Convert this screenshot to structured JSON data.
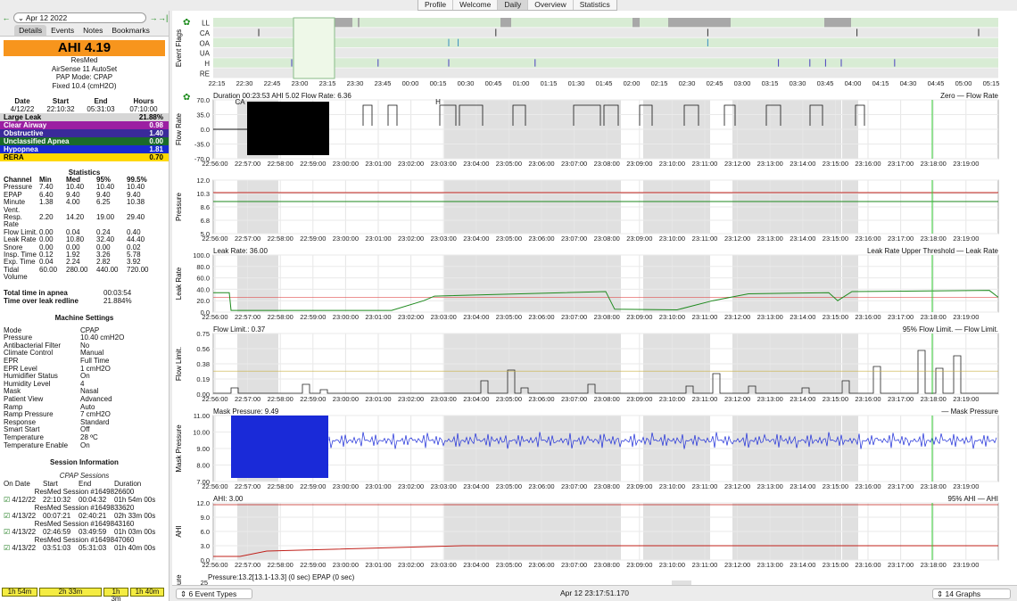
{
  "top_tabs": [
    "Profile",
    "Welcome",
    "Daily",
    "Overview",
    "Statistics"
  ],
  "date_nav": {
    "date": "Apr 12 2022",
    "prev": "←",
    "next": "→",
    "last": "→|"
  },
  "left_tabs": [
    "Details",
    "Events",
    "Notes",
    "Bookmarks"
  ],
  "ahi": {
    "label": "AHI 4.19",
    "brand": "ResMed",
    "model": "AirSense 11 AutoSet",
    "mode": "PAP Mode: CPAP",
    "setting": "Fixed 10.4 (cmH2O)"
  },
  "session_summary": {
    "headers": [
      "Date",
      "Start",
      "End",
      "Hours"
    ],
    "values": [
      "4/12/22",
      "22:10:32",
      "05:31:03",
      "07:10:00"
    ]
  },
  "event_rows": [
    {
      "name": "Large Leak",
      "value": "21.88%",
      "bg": "#d6d6d6",
      "fg": "#000"
    },
    {
      "name": "Clear Airway",
      "value": "0.98",
      "bg": "#9b1fa2",
      "fg": "#fff"
    },
    {
      "name": "Obstructive",
      "value": "1.40",
      "bg": "#3a2a9a",
      "fg": "#fff"
    },
    {
      "name": "Unclassified Apnea",
      "value": "0.00",
      "bg": "#1a6a2a",
      "fg": "#fff"
    },
    {
      "name": "Hypopnea",
      "value": "1.81",
      "bg": "#1a2ad0",
      "fg": "#fff"
    },
    {
      "name": "RERA",
      "value": "0.70",
      "bg": "#ffd800",
      "fg": "#000"
    }
  ],
  "statistics": {
    "title": "Statistics",
    "headers": [
      "Channel",
      "Min",
      "Med",
      "95%",
      "99.5%"
    ],
    "rows": [
      [
        "Pressure",
        "7.40",
        "10.40",
        "10.40",
        "10.40"
      ],
      [
        "EPAP",
        "6.40",
        "9.40",
        "9.40",
        "9.40"
      ],
      [
        "Minute",
        "1.38",
        "4.00",
        "6.25",
        "10.38"
      ],
      [
        "Vent.",
        "",
        "",
        "",
        ""
      ],
      [
        "Resp. Rate",
        "2.20",
        "14.20",
        "19.00",
        "29.40"
      ],
      [
        "Flow Limit.",
        "0.00",
        "0.04",
        "0.24",
        "0.40"
      ],
      [
        "Leak Rate",
        "0.00",
        "10.80",
        "32.40",
        "44.40"
      ],
      [
        "Snore",
        "0.00",
        "0.00",
        "0.00",
        "0.02"
      ],
      [
        "Insp. Time",
        "0.12",
        "1.92",
        "3.26",
        "5.78"
      ],
      [
        "Exp. Time",
        "0.04",
        "2.24",
        "2.82",
        "3.92"
      ],
      [
        "Tidal",
        "60.00",
        "280.00",
        "440.00",
        "720.00"
      ],
      [
        "Volume",
        "",
        "",
        "",
        ""
      ]
    ]
  },
  "totals": [
    {
      "label": "Total time in apnea",
      "value": "00:03:54"
    },
    {
      "label": "Time over leak redline",
      "value": "21.884%"
    }
  ],
  "machine_settings": {
    "title": "Machine Settings",
    "items": [
      [
        "Mode",
        "CPAP"
      ],
      [
        "Pressure",
        "10.40 cmH2O"
      ],
      [
        "Antibacterial Filter",
        "No"
      ],
      [
        "Climate Control",
        "Manual"
      ],
      [
        "EPR",
        "Full Time"
      ],
      [
        "EPR Level",
        "1 cmH2O"
      ],
      [
        "Humidifier Status",
        "On"
      ],
      [
        "Humidity Level",
        "4"
      ],
      [
        "Mask",
        "Nasal"
      ],
      [
        "Patient View",
        "Advanced"
      ],
      [
        "Ramp",
        "Auto"
      ],
      [
        "Ramp Pressure",
        "7 cmH2O"
      ],
      [
        "Response",
        "Standard"
      ],
      [
        "Smart Start",
        "Off"
      ],
      [
        "Temperature",
        "28 ºC"
      ],
      [
        "Temperature Enable",
        "On"
      ]
    ]
  },
  "session_info": {
    "title": "Session Information",
    "subtitle": "CPAP Sessions",
    "headers": [
      "On Date",
      "Start",
      "End",
      "Duration"
    ],
    "sessions": [
      {
        "title": "ResMed Session #1649826600",
        "date": "4/12/22",
        "start": "22:10:32",
        "end": "00:04:32",
        "dur": "01h 54m 00s"
      },
      {
        "title": "ResMed Session #1649833620",
        "date": "4/13/22",
        "start": "00:07:21",
        "end": "02:40:21",
        "dur": "02h 33m 00s"
      },
      {
        "title": "ResMed Session #1649843160",
        "date": "4/13/22",
        "start": "02:46:59",
        "end": "03:49:59",
        "dur": "01h 03m 00s"
      },
      {
        "title": "ResMed Session #1649847060",
        "date": "4/13/22",
        "start": "03:51:03",
        "end": "05:31:03",
        "dur": "01h 40m 00s"
      }
    ]
  },
  "session_buttons": [
    "1h 54m",
    "2h 33m",
    "1h 3m",
    "1h 40m"
  ],
  "overview_times": [
    "22:15",
    "22:30",
    "22:45",
    "23:00",
    "23:15",
    "23:30",
    "23:45",
    "00:00",
    "00:15",
    "00:30",
    "00:45",
    "01:00",
    "01:15",
    "01:30",
    "01:45",
    "02:00",
    "02:15",
    "02:30",
    "02:45",
    "03:00",
    "03:15",
    "03:30",
    "03:45",
    "04:00",
    "04:15",
    "04:30",
    "04:45",
    "05:00",
    "05:15"
  ],
  "detail_times": [
    "22:56:00",
    "22:57:00",
    "22:58:00",
    "22:59:00",
    "23:00:00",
    "23:01:00",
    "23:02:00",
    "23:03:00",
    "23:04:00",
    "23:05:00",
    "23:06:00",
    "23:07:00",
    "23:08:00",
    "23:09:00",
    "23:10:00",
    "23:11:00",
    "23:12:00",
    "23:13:00",
    "23:14:00",
    "23:15:00",
    "23:16:00",
    "23:17:00",
    "23:18:00",
    "23:19:00"
  ],
  "event_flags": {
    "ylabel": "Event Flags",
    "rows": [
      "LL",
      "CA",
      "OA",
      "UA",
      "H",
      "RE"
    ]
  },
  "graphs": [
    {
      "id": "flow",
      "ylabel": "Flow Rate",
      "header": "Duration 00:23:53 AHI 5.02 Flow Rate: 6.36",
      "legend": "Zero — Flow Rate",
      "ticks": [
        "70.0",
        "35.0",
        "0.0",
        "-35.0",
        "-70.0"
      ],
      "marks": [
        "CA",
        "H"
      ]
    },
    {
      "id": "pressure",
      "ylabel": "Pressure",
      "header": "",
      "legend": "",
      "ticks": [
        "12.0",
        "10.3",
        "8.6",
        "6.8",
        "5.0"
      ]
    },
    {
      "id": "leak",
      "ylabel": "Leak Rate",
      "header": "Leak Rate: 36.00",
      "legend": "Leak Rate Upper Threshold — Leak Rate",
      "ticks": [
        "100.0",
        "80.0",
        "60.0",
        "40.0",
        "20.0",
        "0.0"
      ]
    },
    {
      "id": "flowlim",
      "ylabel": "Flow Limit.",
      "header": "Flow Limit.: 0.37",
      "legend": "95% Flow Limit. — Flow Limit.",
      "ticks": [
        "0.75",
        "0.56",
        "0.38",
        "0.19",
        "0.00"
      ]
    },
    {
      "id": "mask",
      "ylabel": "Mask Pressure",
      "header": "Mask Pressure: 9.49",
      "legend": "— Mask Pressure",
      "ticks": [
        "11.00",
        "10.00",
        "9.00",
        "8.00",
        "7.00"
      ]
    },
    {
      "id": "ahi",
      "ylabel": "AHI",
      "header": "AHI: 3.00",
      "legend": "95% AHI — AHI",
      "ticks": [
        "12.0",
        "9.0",
        "6.0",
        "3.0",
        "0.0"
      ]
    },
    {
      "id": "pres2",
      "ylabel": "ure",
      "header": "Pressure:13.2[13.1-13.3] (0 sec)     EPAP (0 sec)",
      "legend": "",
      "ticks": [
        "25"
      ]
    }
  ],
  "bottom": {
    "event_types": "6 Event Types",
    "status_time": "Apr 12 23:17:51.170",
    "graphs_count": "14 Graphs"
  },
  "colors": {
    "ahi_box": "#f7951d",
    "flow_series": "#000000",
    "pressure_series": "#1e8a1e",
    "pressure_high": "#c0201a",
    "leak_series": "#1e8a1e",
    "mask_series": "#1a2ad8",
    "ahi_series": "#c0201a",
    "flag_band": "#d8ecd4",
    "shade": "#e0e0e0",
    "crosshair": "#33cc33"
  }
}
